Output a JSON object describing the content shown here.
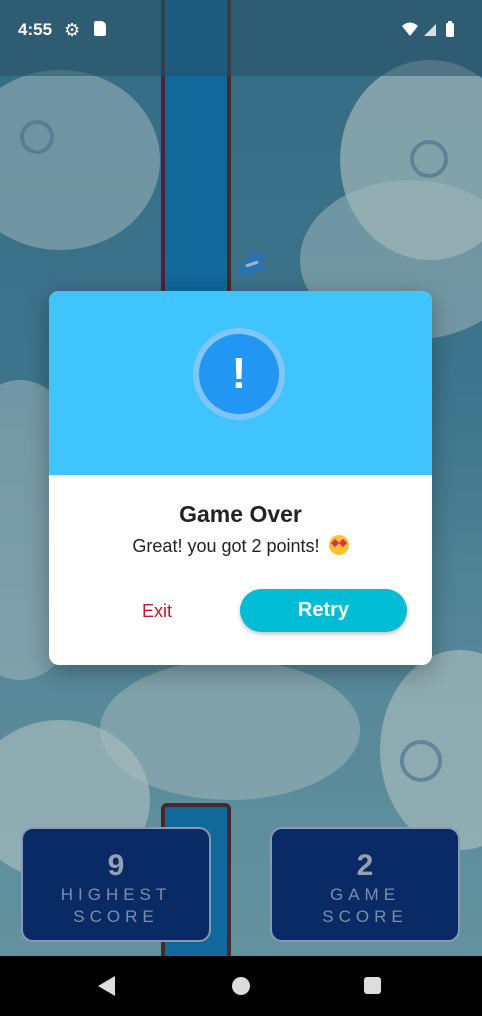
{
  "status_bar": {
    "time": "4:55",
    "icons": [
      "gear-icon",
      "sd-card-icon",
      "wifi-icon",
      "signal-icon",
      "battery-icon"
    ]
  },
  "dialog": {
    "icon": "exclamation-icon",
    "title": "Game Over",
    "message": "Great! you got 2 points!",
    "message_emoji": "star-struck-emoji",
    "exit_label": "Exit",
    "retry_label": "Retry",
    "colors": {
      "header": "#40c4fe",
      "retry": "#00bcd4",
      "exit": "#c0182b"
    }
  },
  "scores": {
    "highest": {
      "value": "9",
      "label_line1": "HIGHEST",
      "label_line2": "SCORE"
    },
    "game": {
      "value": "2",
      "label_line1": "GAME",
      "label_line2": "SCORE"
    }
  },
  "nav": {
    "icons": [
      "back-icon",
      "home-icon",
      "recents-icon"
    ]
  }
}
